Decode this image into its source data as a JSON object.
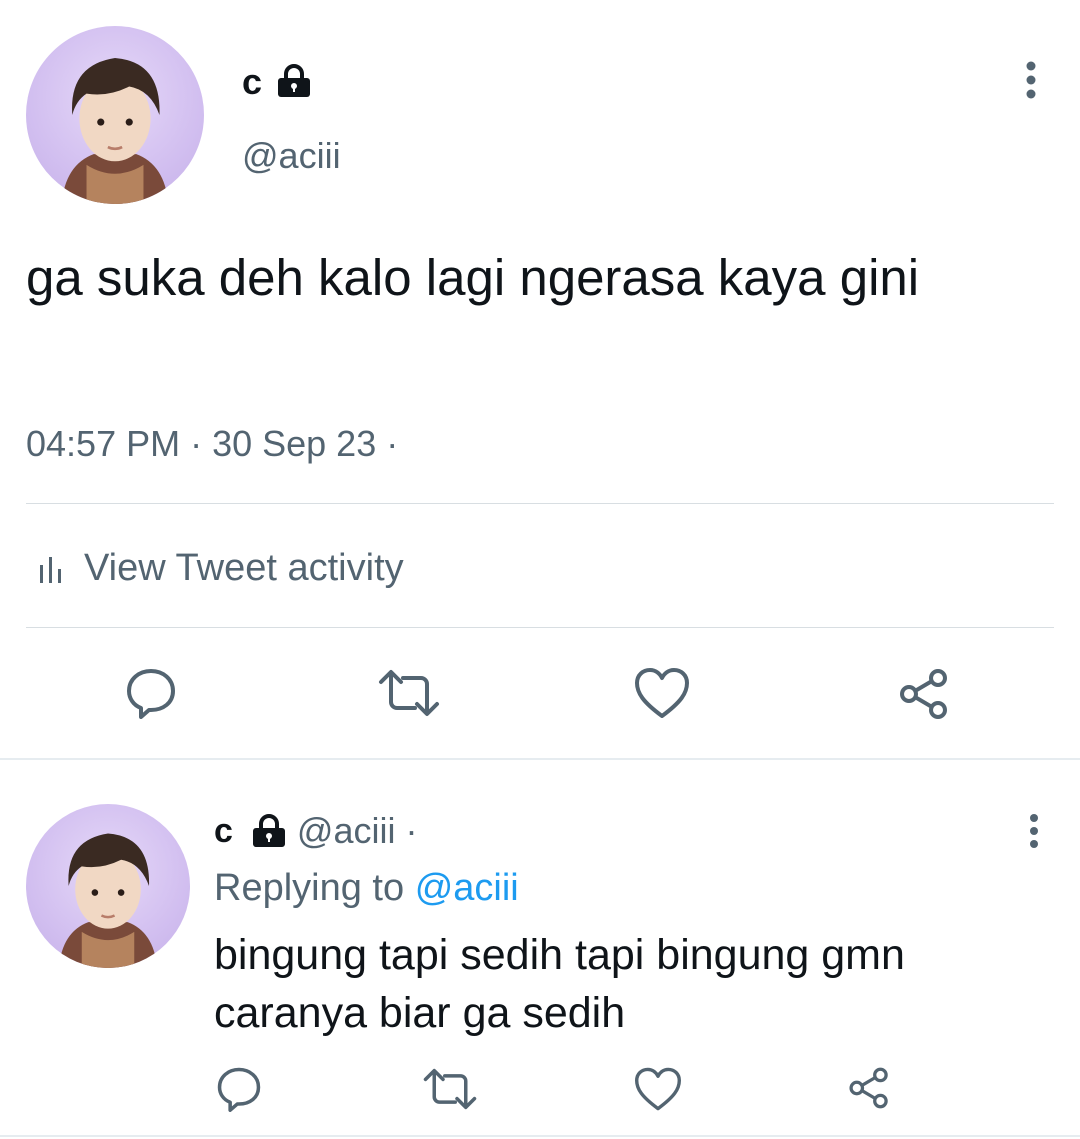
{
  "colors": {
    "text": "#0f1419",
    "muted": "#536471",
    "link": "#1d9bf0",
    "divider": "#d8dee2",
    "avatar_bg": "#d2bff0"
  },
  "main_tweet": {
    "display_name": "c",
    "handle": "@aciii",
    "protected_icon": "lock-icon",
    "text": "ga suka deh kalo lagi ngerasa kaya gini",
    "timestamp": "04:57 PM · 30 Sep 23 ·",
    "activity_label": "View Tweet activity",
    "activity_icon": "bar-chart-icon",
    "actions": [
      "reply-icon",
      "retweet-icon",
      "like-icon",
      "share-icon"
    ]
  },
  "reply_tweet": {
    "display_name": "c",
    "handle": "@aciii ·",
    "protected_icon": "lock-icon",
    "replying_prefix": "Replying to",
    "replying_handle": "@aciii",
    "text": "bingung tapi sedih tapi bingung gmn caranya biar ga sedih",
    "actions": [
      "reply-icon",
      "retweet-icon",
      "like-icon",
      "share-icon"
    ]
  }
}
